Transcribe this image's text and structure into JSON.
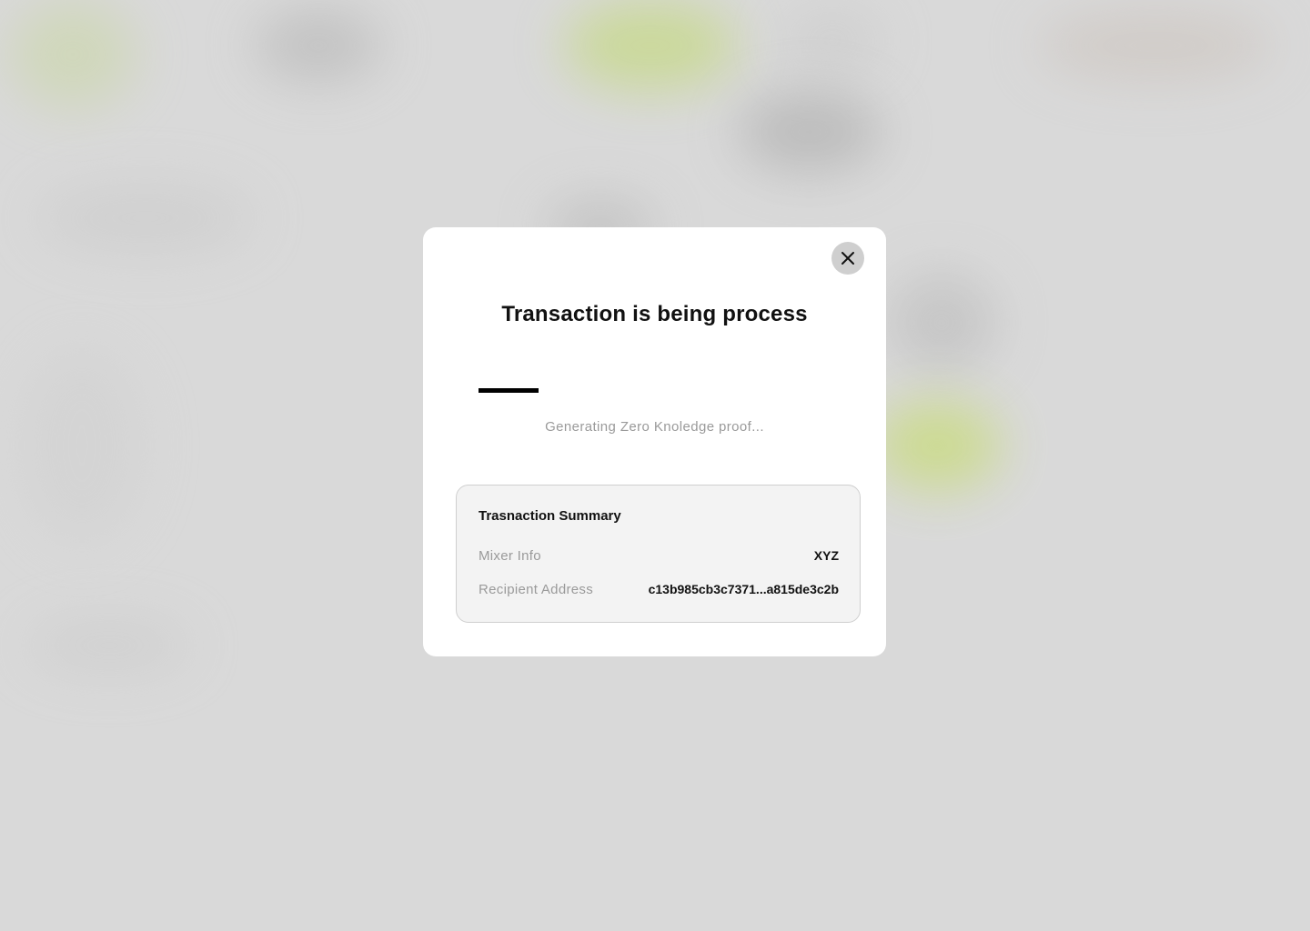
{
  "modal": {
    "title": "Transaction is being process",
    "close_icon": "close-icon",
    "progress": 0.17,
    "status": "Generating Zero Knoledge proof...",
    "summary": {
      "title": "Trasnaction Summary",
      "rows": [
        {
          "label": "Mixer Info",
          "value": "XYZ"
        },
        {
          "label": "Recipient Address",
          "value": "c13b985cb3c7371...a815de3c2b"
        }
      ]
    }
  }
}
